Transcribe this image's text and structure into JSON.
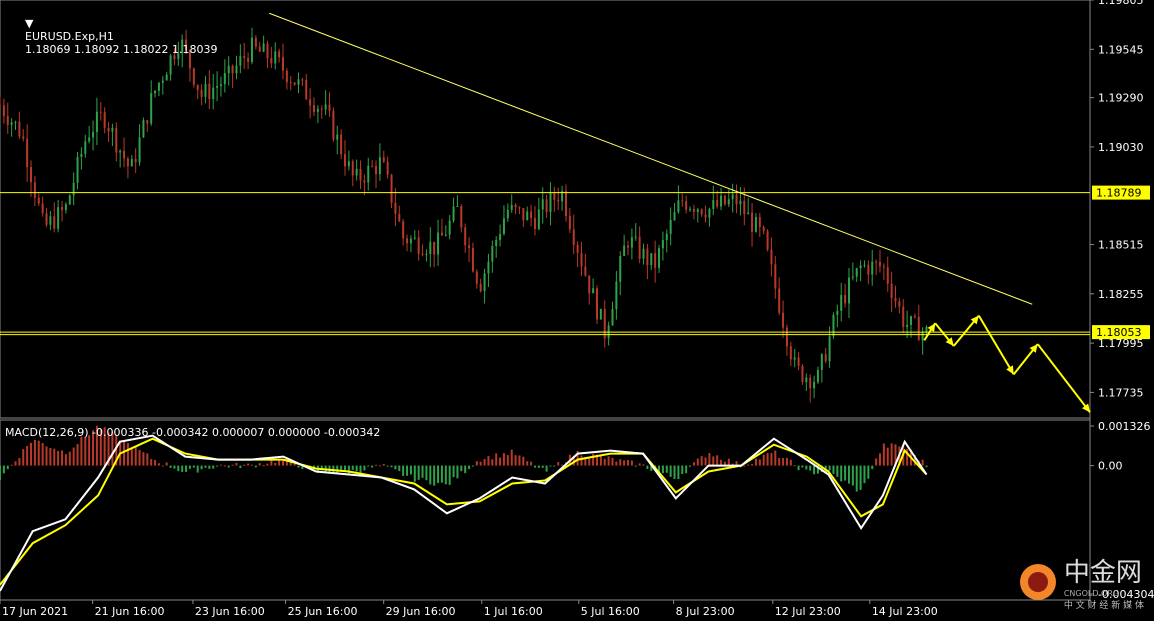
{
  "header": {
    "symbol": "EURUSD.Exp,H1",
    "ohlc": "1.18069 1.18092 1.18022 1.18039"
  },
  "macd_header": "MACD(12,26,9) -0.000336 -0.000342 0.000007 0.000000 -0.000342",
  "watermark": {
    "cn": "中金网",
    "en": "CNGOLD.ORG",
    "sub": "中 文 财 经 新 媒 体"
  },
  "colors": {
    "bull": "#2fa34a",
    "bear": "#b93a2a",
    "hline": "#ffff00",
    "trend": "#ffff66",
    "macd_line": "#ffffff",
    "signal_line": "#ffff00",
    "hist_pos": "#b93a2a",
    "hist_neg": "#2fa34a",
    "label_bg": "#ffff00"
  },
  "chart_data": [
    {
      "type": "candlestick",
      "title": "EURUSD.Exp,H1",
      "ylim": [
        1.176,
        1.19805
      ],
      "price_ticks": [
        "1.19805",
        "1.19545",
        "1.19290",
        "1.19030",
        "1.18515",
        "1.18255",
        "1.17995",
        "1.17735"
      ],
      "x_ticks": [
        "17 Jun 2021",
        "21 Jun 16:00",
        "23 Jun 16:00",
        "25 Jun 16:00",
        "29 Jun 16:00",
        "1 Jul 16:00",
        "5 Jul 16:00",
        "8 Jul 23:00",
        "12 Jul 23:00",
        "14 Jul 23:00"
      ],
      "horizontal_lines": [
        {
          "price": 1.18789,
          "label": "1.18789"
        },
        {
          "price": 1.18053,
          "label": "1.18053"
        },
        {
          "price": 1.1804,
          "label": ""
        }
      ],
      "trendline": {
        "from": {
          "bar": 0.247,
          "price": 1.19735
        },
        "to": {
          "bar": 0.947,
          "price": 1.182
        }
      },
      "path_anchors": [
        {
          "bar": 0.0,
          "price": 1.1925
        },
        {
          "bar": 0.02,
          "price": 1.191
        },
        {
          "bar": 0.04,
          "price": 1.186
        },
        {
          "bar": 0.06,
          "price": 1.187
        },
        {
          "bar": 0.08,
          "price": 1.191
        },
        {
          "bar": 0.095,
          "price": 1.192
        },
        {
          "bar": 0.12,
          "price": 1.189
        },
        {
          "bar": 0.14,
          "price": 1.193
        },
        {
          "bar": 0.165,
          "price": 1.196
        },
        {
          "bar": 0.185,
          "price": 1.193
        },
        {
          "bar": 0.21,
          "price": 1.194
        },
        {
          "bar": 0.23,
          "price": 1.1955
        },
        {
          "bar": 0.25,
          "price": 1.195
        },
        {
          "bar": 0.275,
          "price": 1.1935
        },
        {
          "bar": 0.3,
          "price": 1.192
        },
        {
          "bar": 0.325,
          "price": 1.1885
        },
        {
          "bar": 0.35,
          "price": 1.1895
        },
        {
          "bar": 0.37,
          "price": 1.1855
        },
        {
          "bar": 0.4,
          "price": 1.185
        },
        {
          "bar": 0.42,
          "price": 1.187
        },
        {
          "bar": 0.44,
          "price": 1.183
        },
        {
          "bar": 0.465,
          "price": 1.187
        },
        {
          "bar": 0.49,
          "price": 1.1865
        },
        {
          "bar": 0.515,
          "price": 1.188
        },
        {
          "bar": 0.535,
          "price": 1.184
        },
        {
          "bar": 0.555,
          "price": 1.1805
        },
        {
          "bar": 0.575,
          "price": 1.1855
        },
        {
          "bar": 0.6,
          "price": 1.184
        },
        {
          "bar": 0.625,
          "price": 1.1875
        },
        {
          "bar": 0.65,
          "price": 1.187
        },
        {
          "bar": 0.675,
          "price": 1.1875
        },
        {
          "bar": 0.7,
          "price": 1.1855
        },
        {
          "bar": 0.73,
          "price": 1.1785
        },
        {
          "bar": 0.75,
          "price": 1.178
        },
        {
          "bar": 0.77,
          "price": 1.182
        },
        {
          "bar": 0.79,
          "price": 1.184
        },
        {
          "bar": 0.81,
          "price": 1.184
        },
        {
          "bar": 0.83,
          "price": 1.181
        },
        {
          "bar": 0.85,
          "price": 1.1805
        }
      ],
      "forecast_path": [
        {
          "bar": 0.848,
          "price": 1.1801
        },
        {
          "bar": 0.858,
          "price": 1.181
        },
        {
          "bar": 0.875,
          "price": 1.1798
        },
        {
          "bar": 0.898,
          "price": 1.1814
        },
        {
          "bar": 0.93,
          "price": 1.1783
        },
        {
          "bar": 0.952,
          "price": 1.1799
        },
        {
          "bar": 1.0,
          "price": 1.1763
        }
      ]
    },
    {
      "type": "line",
      "title": "MACD(12,26,9)",
      "ylim": [
        -0.004304,
        0.001326
      ],
      "y_ticks": [
        "0.001326",
        "0.00",
        "-0.004304"
      ],
      "series": [
        {
          "name": "MACD",
          "x": [
            0,
            0.03,
            0.06,
            0.09,
            0.11,
            0.14,
            0.17,
            0.2,
            0.23,
            0.26,
            0.29,
            0.32,
            0.35,
            0.38,
            0.41,
            0.44,
            0.47,
            0.5,
            0.53,
            0.56,
            0.59,
            0.62,
            0.65,
            0.68,
            0.71,
            0.74,
            0.76,
            0.79,
            0.81,
            0.83,
            0.85
          ],
          "y": [
            -0.0042,
            -0.0022,
            -0.0018,
            -0.0004,
            0.0008,
            0.001,
            0.0003,
            0.0002,
            0.0002,
            0.0003,
            -0.0002,
            -0.0003,
            -0.0004,
            -0.0008,
            -0.0016,
            -0.0011,
            -0.0004,
            -0.0006,
            0.0004,
            0.0005,
            0.0004,
            -0.0011,
            0.0,
            0.0,
            0.0009,
            0.0002,
            -0.0003,
            -0.0021,
            -0.001,
            0.0008,
            -0.0003
          ]
        },
        {
          "name": "Signal",
          "x": [
            0,
            0.03,
            0.06,
            0.09,
            0.11,
            0.14,
            0.17,
            0.2,
            0.23,
            0.26,
            0.29,
            0.32,
            0.35,
            0.38,
            0.41,
            0.44,
            0.47,
            0.5,
            0.53,
            0.56,
            0.59,
            0.62,
            0.65,
            0.68,
            0.71,
            0.74,
            0.76,
            0.79,
            0.81,
            0.83,
            0.85
          ],
          "y": [
            -0.004,
            -0.0026,
            -0.002,
            -0.001,
            0.0004,
            0.0009,
            0.0004,
            0.0002,
            0.0002,
            0.0002,
            -0.0001,
            -0.0002,
            -0.0004,
            -0.0006,
            -0.0013,
            -0.0012,
            -0.0006,
            -0.0005,
            0.0002,
            0.0004,
            0.0004,
            -0.0009,
            -0.0002,
            0.0,
            0.0007,
            0.0003,
            -0.0002,
            -0.0017,
            -0.0013,
            0.0005,
            -0.0003
          ]
        }
      ]
    }
  ]
}
